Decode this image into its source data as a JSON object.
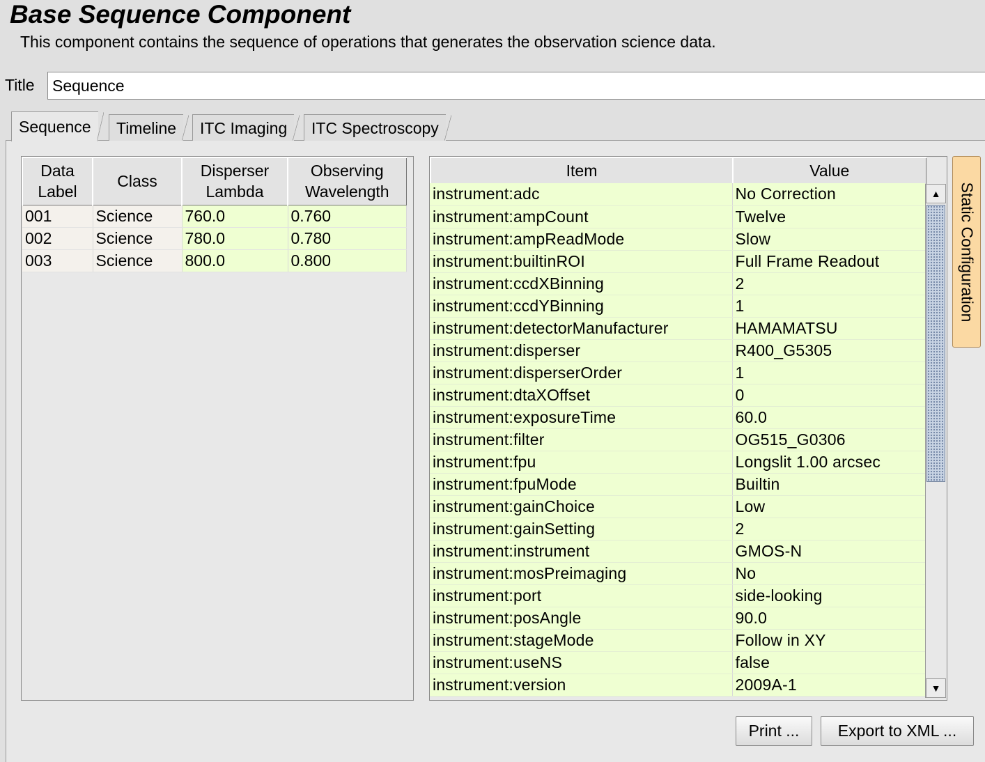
{
  "component": {
    "title": "Base Sequence Component",
    "description": "This component contains the sequence of operations that generates the observation science data."
  },
  "title_field": {
    "label": "Title",
    "value": "Sequence"
  },
  "tabs": [
    {
      "label": "Sequence",
      "active": true
    },
    {
      "label": "Timeline",
      "active": false
    },
    {
      "label": "ITC Imaging",
      "active": false
    },
    {
      "label": "ITC Spectroscopy",
      "active": false
    }
  ],
  "sequence_table": {
    "headers": [
      [
        "Data",
        "Label"
      ],
      [
        "Class",
        ""
      ],
      [
        "Disperser",
        "Lambda"
      ],
      [
        "Observing",
        "Wavelength"
      ]
    ],
    "rows": [
      [
        "001",
        "Science",
        "760.0",
        "0.760"
      ],
      [
        "002",
        "Science",
        "780.0",
        "0.780"
      ],
      [
        "003",
        "Science",
        "800.0",
        "0.800"
      ]
    ]
  },
  "config_table": {
    "headers": [
      "Item",
      "Value"
    ],
    "rows": [
      [
        "instrument:adc",
        "No Correction"
      ],
      [
        "instrument:ampCount",
        "Twelve"
      ],
      [
        "instrument:ampReadMode",
        "Slow"
      ],
      [
        "instrument:builtinROI",
        "Full Frame Readout"
      ],
      [
        "instrument:ccdXBinning",
        "2"
      ],
      [
        "instrument:ccdYBinning",
        "1"
      ],
      [
        "instrument:detectorManufacturer",
        "HAMAMATSU"
      ],
      [
        "instrument:disperser",
        "R400_G5305"
      ],
      [
        "instrument:disperserOrder",
        "1"
      ],
      [
        "instrument:dtaXOffset",
        "0"
      ],
      [
        "instrument:exposureTime",
        "60.0"
      ],
      [
        "instrument:filter",
        "OG515_G0306"
      ],
      [
        "instrument:fpu",
        "Longslit 1.00 arcsec"
      ],
      [
        "instrument:fpuMode",
        "Builtin"
      ],
      [
        "instrument:gainChoice",
        "Low"
      ],
      [
        "instrument:gainSetting",
        "2"
      ],
      [
        "instrument:instrument",
        "GMOS-N"
      ],
      [
        "instrument:mosPreimaging",
        "No"
      ],
      [
        "instrument:port",
        "side-looking"
      ],
      [
        "instrument:posAngle",
        "90.0"
      ],
      [
        "instrument:stageMode",
        "Follow in XY"
      ],
      [
        "instrument:useNS",
        "false"
      ],
      [
        "instrument:version",
        "2009A-1"
      ]
    ]
  },
  "side_tab": {
    "label": "Static Configuration"
  },
  "buttons": {
    "print": "Print ...",
    "export": "Export to XML ..."
  },
  "icons": {
    "scroll_up": "arrow-up-icon",
    "scroll_down": "arrow-down-icon"
  },
  "colors": {
    "cell_value_bg": "#efffd2",
    "side_tab_bg": "#fbd9a3"
  }
}
